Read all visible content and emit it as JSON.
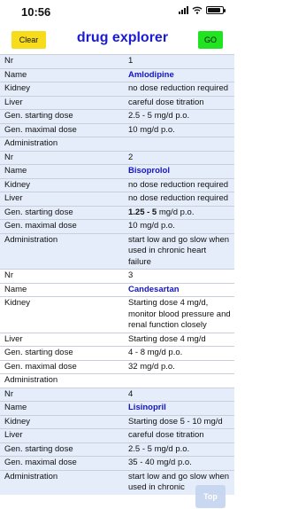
{
  "status_bar": {
    "time": "10:56",
    "icons": [
      "signal-icon",
      "wifi-icon",
      "battery-icon"
    ]
  },
  "header": {
    "clear_label": "Clear",
    "title": "drug explorer",
    "go_label": "GO"
  },
  "labels": {
    "nr": "Nr",
    "name": "Name",
    "kidney": "Kidney",
    "liver": "Liver",
    "start": "Gen. starting dose",
    "max": "Gen. maximal dose",
    "admin": "Administration"
  },
  "drugs": [
    {
      "nr": "1",
      "name": "Amlodipine",
      "kidney": "no dose reduction required",
      "liver": "careful dose titration",
      "start_bold": "",
      "start_rest": "2.5 - 5 mg/d p.o.",
      "max": "10 mg/d p.o.",
      "admin": ""
    },
    {
      "nr": "2",
      "name": "Bisoprolol",
      "kidney": "no dose reduction required",
      "liver": "no dose reduction required",
      "start_bold": "1.25 - 5",
      "start_rest": " mg/d p.o.",
      "max": "10 mg/d p.o.",
      "admin": "start low and go slow when used in chronic heart failure"
    },
    {
      "nr": "3",
      "name": "Candesartan",
      "kidney": "Starting dose 4 mg/d, monitor blood pressure and renal function closely",
      "liver": "Starting dose 4 mg/d",
      "start_bold": "",
      "start_rest": "4 - 8 mg/d p.o.",
      "max": "32 mg/d p.o.",
      "admin": ""
    },
    {
      "nr": "4",
      "name": "Lisinopril",
      "kidney": "Starting dose 5 - 10 mg/d",
      "liver": "careful dose titration",
      "start_bold": "",
      "start_rest": "2.5 - 5 mg/d p.o.",
      "max": "35 - 40 mg/d p.o.",
      "admin": "start low and go slow when used in chronic"
    }
  ],
  "top_button_label": "Top",
  "colors": {
    "title": "#1b1bd6",
    "drug_name": "#1414c8",
    "clear_button": "#f7dc1c",
    "go_button": "#1fe41f",
    "odd_row_bg": "#e4edf9"
  }
}
